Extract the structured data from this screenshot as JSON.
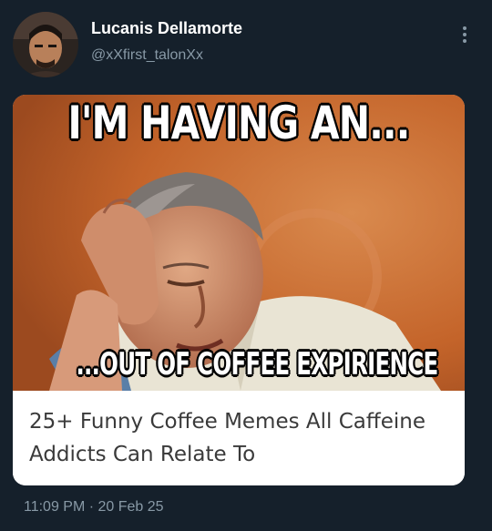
{
  "author": {
    "name": "Lucanis Dellamorte",
    "handle": "@xXfirst_talonXx",
    "avatar_icon": "profile-avatar"
  },
  "menu": {
    "icon": "more-options-icon"
  },
  "media": {
    "top_text": "I'M HAVING AN...",
    "bottom_text": "...OUT OF COFFEE EXPIRIENCE",
    "background_color": "#c4642a"
  },
  "card": {
    "title": "25+ Funny Coffee Memes All Caffeine Addicts Can Relate To"
  },
  "meta": {
    "timestamp": "11:09 PM · 20 Feb 25"
  },
  "colors": {
    "background": "#15202b",
    "secondary_text": "#8899a6",
    "primary_text": "#ffffff"
  }
}
